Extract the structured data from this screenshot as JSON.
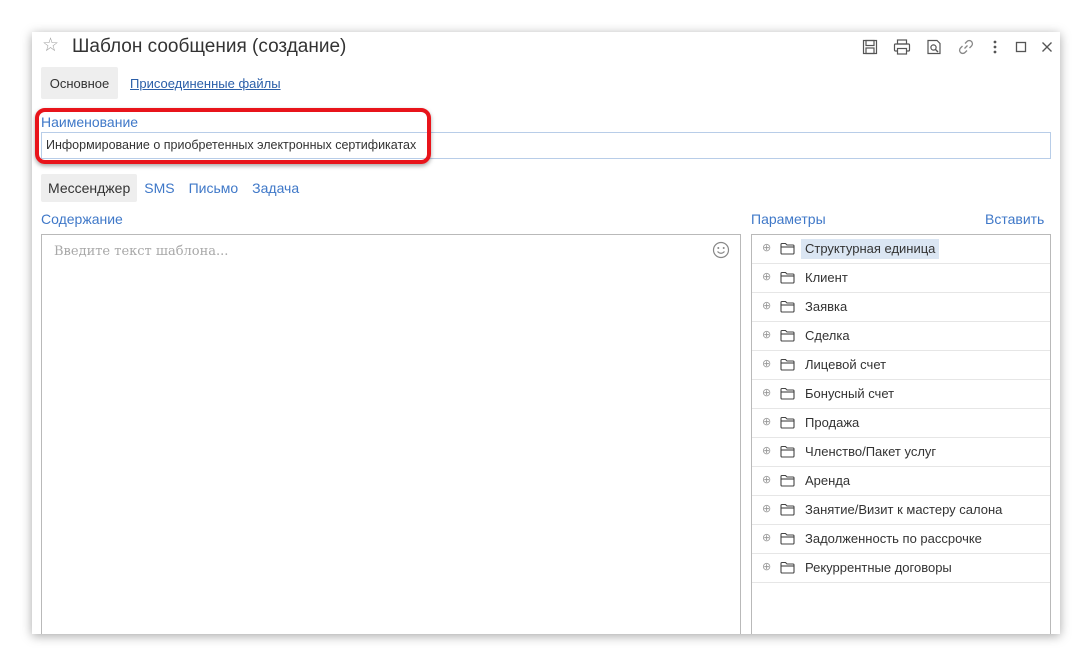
{
  "window": {
    "title": "Шаблон сообщения (создание)"
  },
  "toolbar_icons": [
    "save-icon",
    "print-icon",
    "preview-icon",
    "link-icon",
    "more-icon",
    "maximize-icon",
    "close-icon"
  ],
  "tabs": {
    "main": "Основное",
    "files": "Присоединенные файлы"
  },
  "name_field": {
    "label": "Наименование",
    "value": "Информирование о приобретенных электронных сертификатах"
  },
  "channel_tabs": [
    {
      "label": "Мессенджер",
      "active": true
    },
    {
      "label": "SMS",
      "active": false
    },
    {
      "label": "Письмо",
      "active": false
    },
    {
      "label": "Задача",
      "active": false
    }
  ],
  "content": {
    "label": "Содержание",
    "placeholder": "Введите текст шаблона..."
  },
  "params": {
    "label": "Параметры",
    "insert_label": "Вставить",
    "items": [
      {
        "label": "Структурная единица",
        "selected": true
      },
      {
        "label": "Клиент"
      },
      {
        "label": "Заявка"
      },
      {
        "label": "Сделка"
      },
      {
        "label": "Лицевой счет"
      },
      {
        "label": "Бонусный счет"
      },
      {
        "label": "Продажа"
      },
      {
        "label": "Членство/Пакет услуг"
      },
      {
        "label": "Аренда"
      },
      {
        "label": "Занятие/Визит к мастеру салона"
      },
      {
        "label": "Задолженность по рассрочке"
      },
      {
        "label": "Рекуррентные договоры"
      }
    ]
  },
  "colors": {
    "accent": "#3f78c8",
    "highlight": "#e8141b",
    "selection": "#dbe6f3"
  }
}
